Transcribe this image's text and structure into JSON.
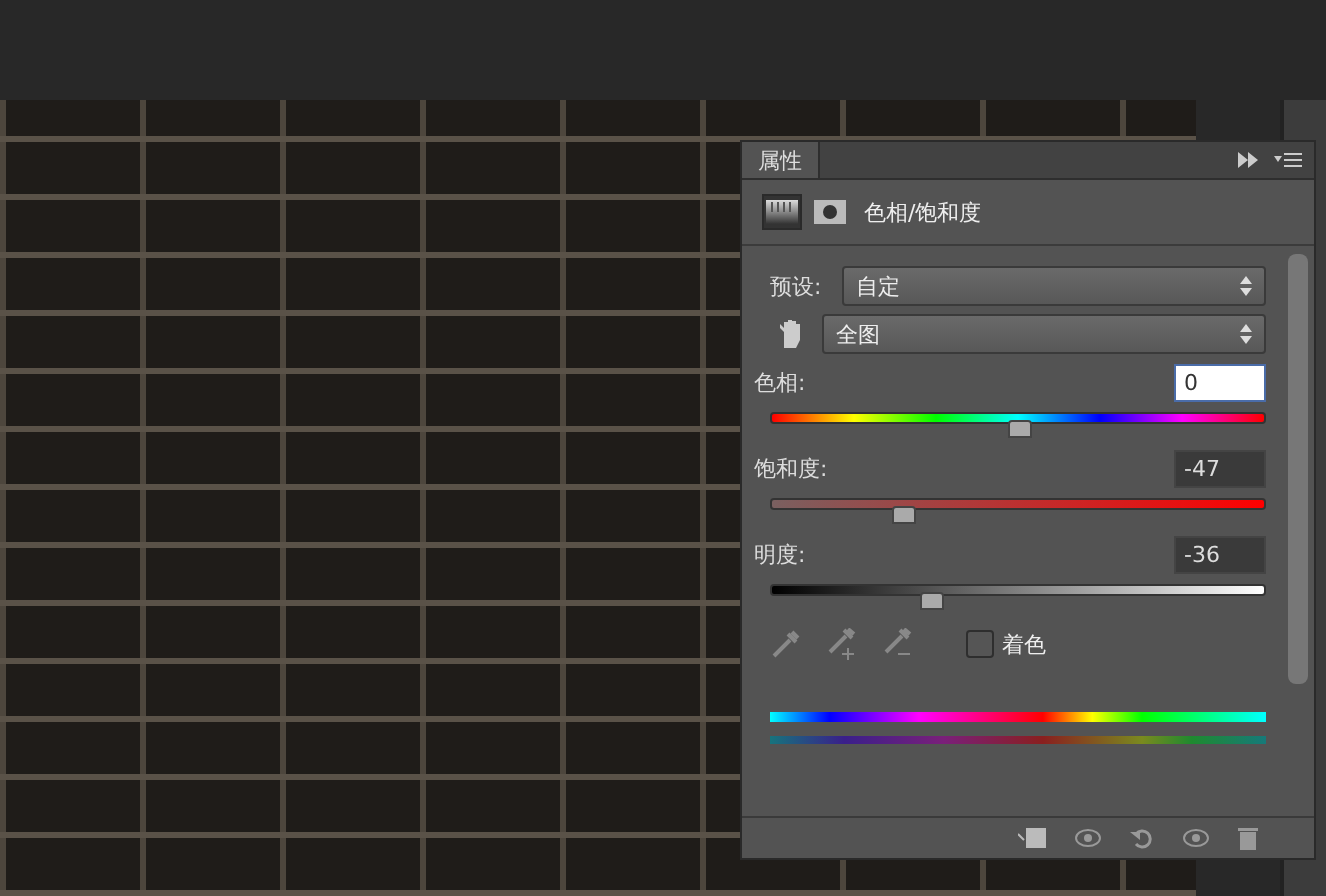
{
  "panel": {
    "tab": "属性",
    "title": "色相/饱和度",
    "preset": {
      "label": "预设:",
      "value": "自定"
    },
    "channel": {
      "value": "全图"
    },
    "sliders": [
      {
        "kind": "hue",
        "label": "色相:",
        "value": "0",
        "focused": true,
        "level": 0.5
      },
      {
        "kind": "saturation",
        "label": "饱和度:",
        "value": "-47",
        "focused": false,
        "level": 0.265
      },
      {
        "kind": "lightness",
        "label": "明度:",
        "value": "-36",
        "focused": false,
        "level": 0.32
      }
    ],
    "colorize": {
      "label": "着色",
      "checked": false
    }
  }
}
